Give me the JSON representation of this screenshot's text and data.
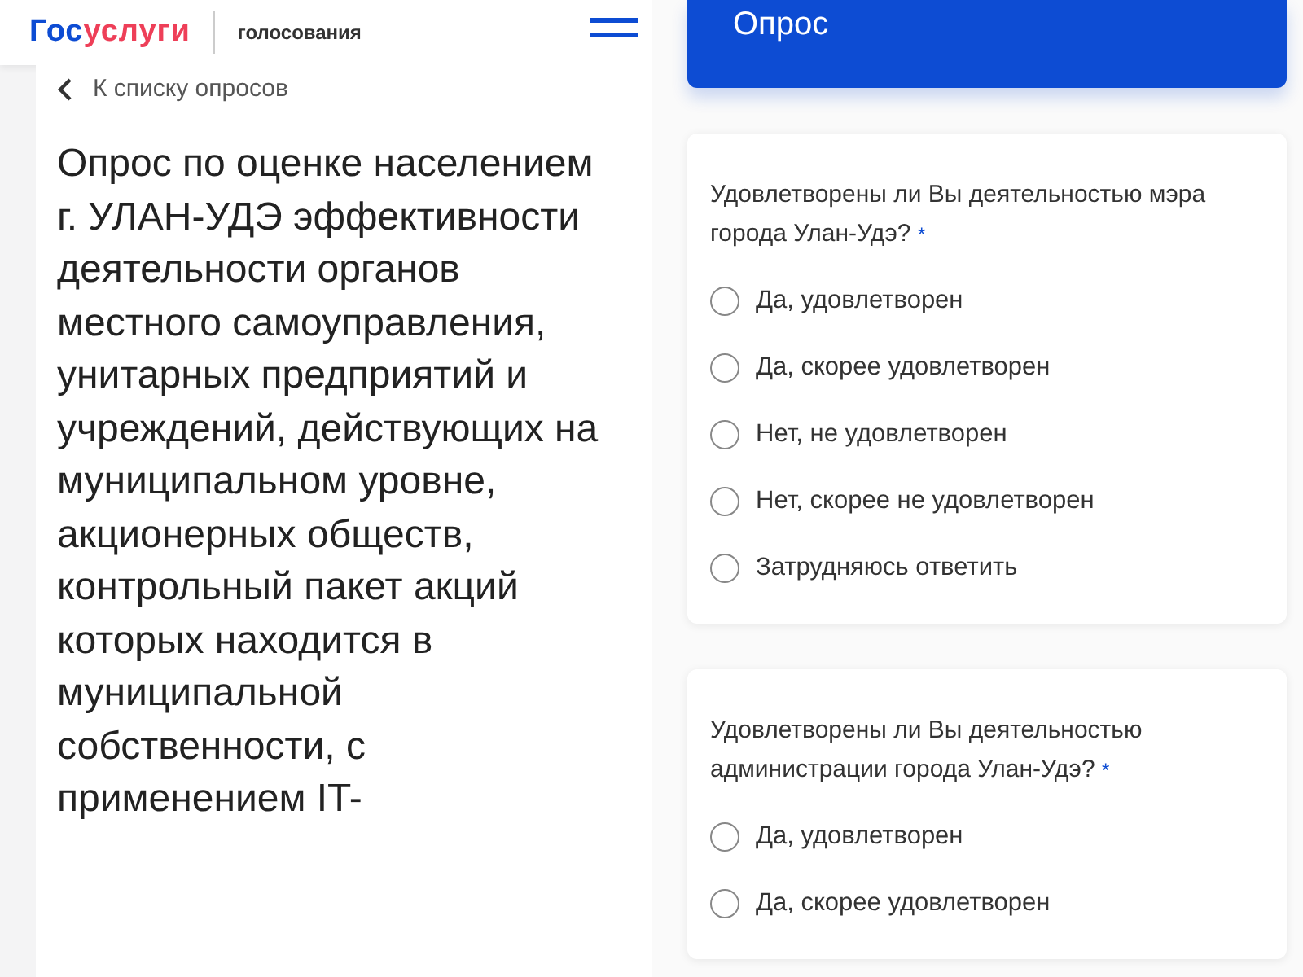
{
  "left_screen": {
    "header": {
      "logo": [
        "Гос",
        "услуги"
      ],
      "subtitle": "голосования"
    },
    "back_link": "К списку опросов",
    "survey_title": "Опрос по оценке населением г. УЛАН-УДЭ эффективности деятельности органов местного самоуправления, унитарных предприятий и учреждений, действующих на муниципальном уровне, акционерных обществ, контрольный пакет акций которых находится в муниципальной собственности, с применением IT-"
  },
  "right_screen": {
    "banner_title": "Опрос",
    "questions": [
      {
        "text": "Удовлетворены ли Вы деятельностью мэра города Улан-Удэ?",
        "required_mark": "*",
        "options": [
          {
            "label": "Да, удовлетворен",
            "selected": false
          },
          {
            "label": "Да, скорее удовлетворен",
            "selected": false
          },
          {
            "label": "Нет, не удовлетворен",
            "selected": false
          },
          {
            "label": "Нет, скорее не удовлетворен",
            "selected": false
          },
          {
            "label": "Затрудняюсь ответить",
            "selected": false
          }
        ]
      },
      {
        "text": "Удовлетворены ли Вы деятельностью администрации города Улан-Удэ?",
        "required_mark": "*",
        "options": [
          {
            "label": "Да, удовлетворен",
            "selected": false
          },
          {
            "label": "Да, скорее удовлетворен",
            "selected": false
          }
        ]
      }
    ]
  }
}
